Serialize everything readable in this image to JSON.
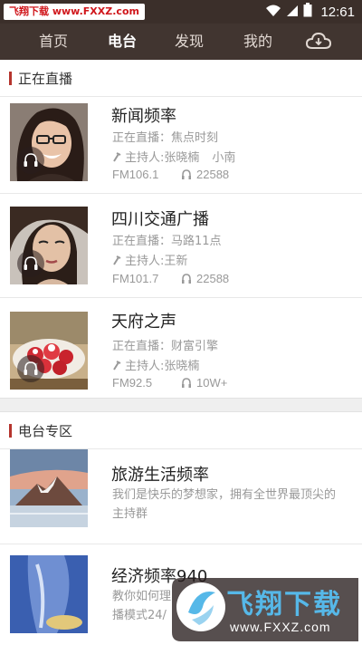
{
  "status_bar": {
    "watermark": "飞翔下载 www.FXXZ.com",
    "time": "12:61"
  },
  "nav": {
    "tabs": [
      {
        "label": "首页",
        "active": false
      },
      {
        "label": "电台",
        "active": true
      },
      {
        "label": "发现",
        "active": false
      },
      {
        "label": "我的",
        "active": false
      }
    ],
    "cloud_icon": "cloud-download-icon"
  },
  "live": {
    "section_title": "正在直播",
    "stations": [
      {
        "name": "新闻频率",
        "now_playing": "正在直播：焦点时刻",
        "hosts": "主持人:张晓楠",
        "host2": "小南",
        "freq": "FM106.1",
        "listeners": "22588",
        "thumb": "woman-with-glasses"
      },
      {
        "name": "四川交通广播",
        "now_playing": "正在直播：马路11点",
        "hosts": "主持人:王新",
        "host2": "",
        "freq": "FM101.7",
        "listeners": "22588",
        "thumb": "woman-portrait"
      },
      {
        "name": "天府之声",
        "now_playing": "正在直播：财富引擎",
        "hosts": "主持人:张晓楠",
        "host2": "",
        "freq": "FM92.5",
        "listeners": "10W+",
        "thumb": "strawberry-dessert"
      }
    ]
  },
  "zone": {
    "section_title": "电台专区",
    "items": [
      {
        "name": "旅游生活频率",
        "desc": "我们是快乐的梦想家，拥有全世界最顶尖的主持群",
        "thumb": "snow-mountain"
      },
      {
        "name": "经济频率940",
        "desc_line1": "教你如何理",
        "desc_line2": "播模式24/",
        "thumb": "blue-glass"
      }
    ]
  },
  "watermark_bottom": {
    "logo": "飞翔下载",
    "url": "www.FXXZ.com"
  },
  "colors": {
    "status_bg": "#3b2f2a",
    "nav_bg": "#413530",
    "accent": "#b5342d",
    "watermark_blue": "#56b8e8"
  }
}
